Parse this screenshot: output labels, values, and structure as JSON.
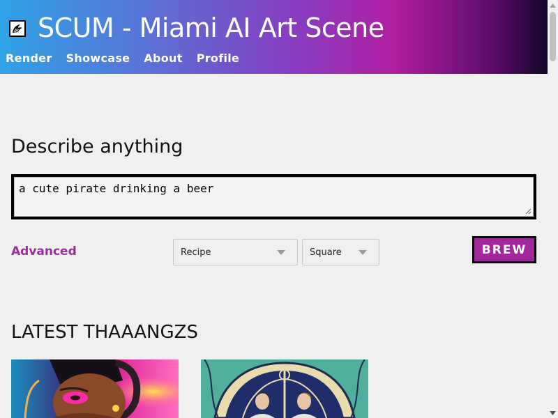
{
  "header": {
    "title": "SCUM - Miami AI Art Scene",
    "logo_icon": "eagle-icon",
    "nav": [
      "Render",
      "Showcase",
      "About",
      "Profile"
    ]
  },
  "prompt": {
    "heading": "Describe anything",
    "value": "a cute pirate drinking a beer"
  },
  "controls": {
    "advanced_label": "Advanced",
    "recipe_selected": "Recipe",
    "shape_selected": "Square",
    "brew_label": "BREW"
  },
  "gallery": {
    "heading": "LATEST THAAANGZS",
    "items": [
      "portrait-image",
      "art-nouveau-image"
    ]
  },
  "colors": {
    "accent": "#9b2c9b",
    "button": "#a0289a",
    "header_gradient": [
      "#2fa4e6",
      "#b11ea2",
      "#14062a"
    ]
  }
}
